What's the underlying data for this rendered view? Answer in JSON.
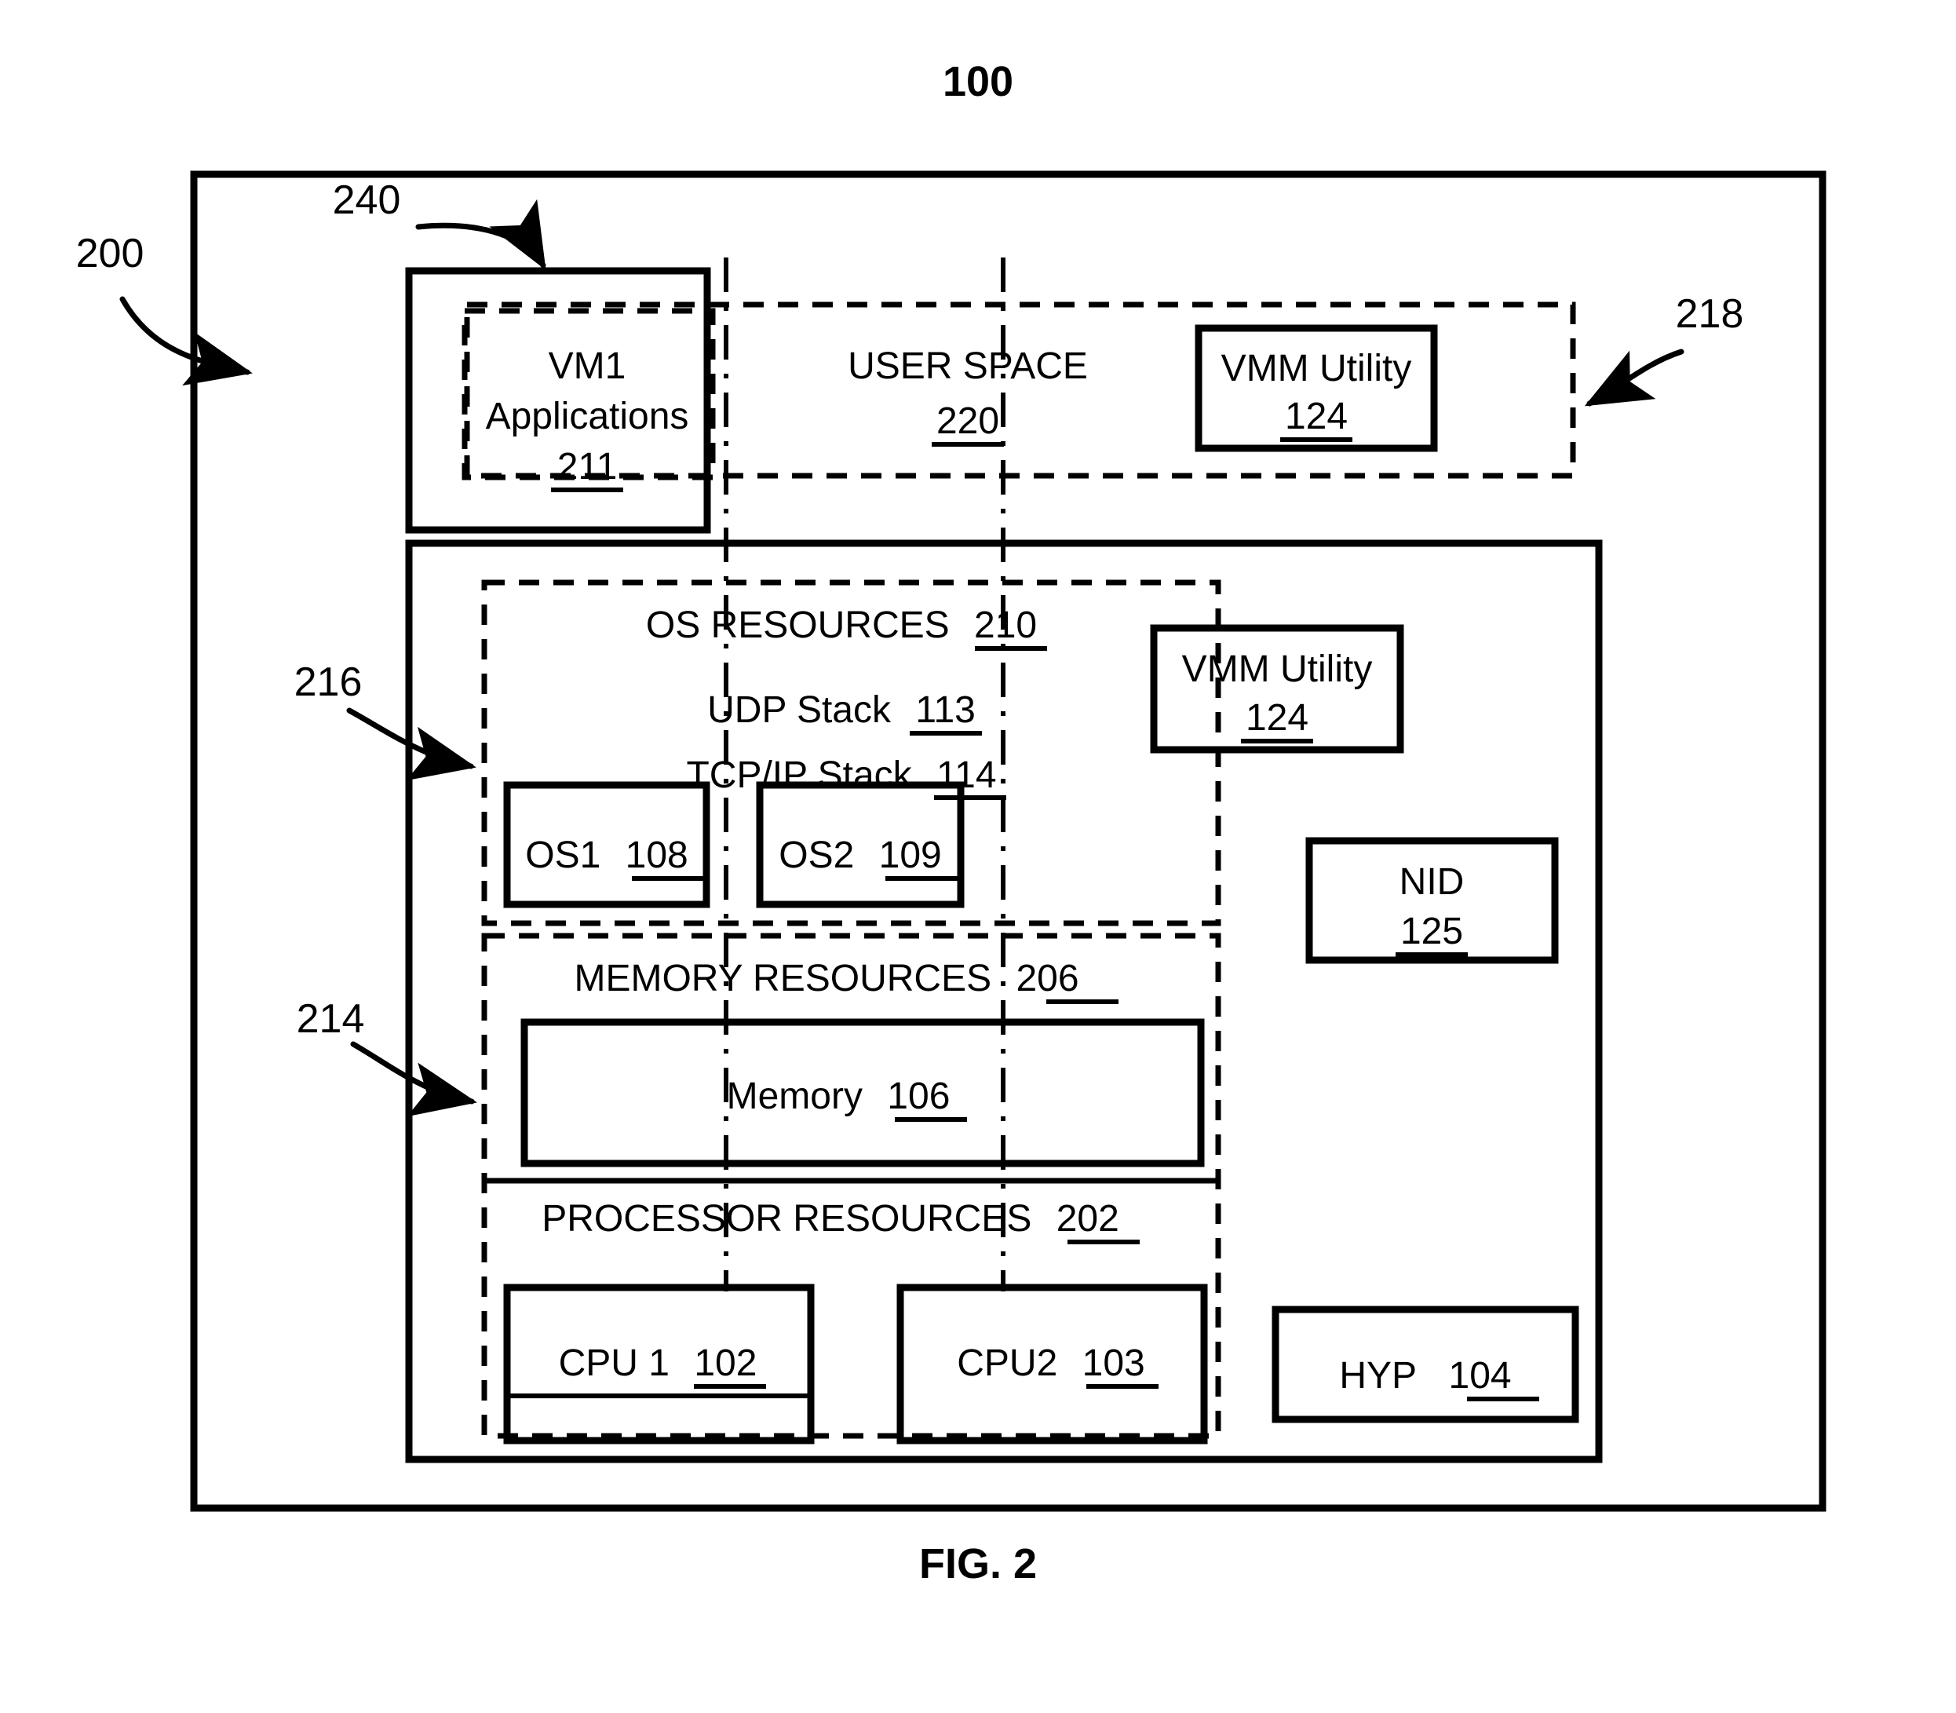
{
  "figure": {
    "top_number": "100",
    "caption": "FIG. 2"
  },
  "reference_labels": [
    {
      "id": "ref-200",
      "text": "200"
    },
    {
      "id": "ref-240",
      "text": "240"
    },
    {
      "id": "ref-218",
      "text": "218"
    },
    {
      "id": "ref-216",
      "text": "216"
    },
    {
      "id": "ref-214",
      "text": "214"
    }
  ],
  "user_space": {
    "title": "USER SPACE",
    "number": "220",
    "vm1": {
      "line1": "VM1",
      "line2": "Applications",
      "number": "211"
    },
    "vmm_utility": {
      "label": "VMM Utility",
      "number": "124"
    }
  },
  "kernel": {
    "os_resources": {
      "title": "OS RESOURCES",
      "number": "210",
      "udp_stack": {
        "label": "UDP Stack",
        "number": "113"
      },
      "tcpip_stack": {
        "label": "TCP/IP Stack",
        "number": "114"
      },
      "os1": {
        "label": "OS1",
        "number": "108"
      },
      "os2": {
        "label": "OS2",
        "number": "109"
      }
    },
    "vmm_utility": {
      "label": "VMM Utility",
      "number": "124"
    },
    "nid": {
      "label": "NID",
      "number": "125"
    },
    "memory_resources": {
      "title": "MEMORY RESOURCES",
      "number": "206",
      "memory": {
        "label": "Memory",
        "number": "106"
      }
    },
    "processor_resources": {
      "title": "PROCESSOR RESOURCES",
      "number": "202",
      "cpu1": {
        "label": "CPU 1",
        "number": "102"
      },
      "cpu2": {
        "label": "CPU2",
        "number": "103"
      }
    },
    "hypervisor": {
      "label": "HYP",
      "number": "104"
    }
  },
  "colors": {
    "stroke": "#000000",
    "background": "#ffffff"
  }
}
